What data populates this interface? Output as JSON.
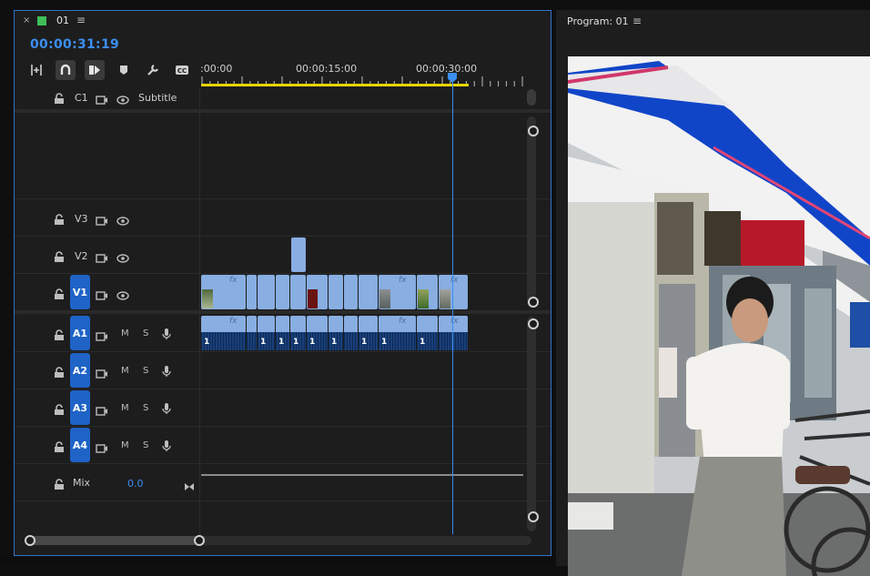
{
  "sequence_panel": {
    "close_glyph": "×",
    "tab_name": "01",
    "tab_swatch_color": "#3fbf5a",
    "menu_glyph": "≡",
    "timecode": "00:00:31:19",
    "tools": [
      "ripple-insert-icon",
      "snap-magnet-icon",
      "linked-selection-icon",
      "add-marker-icon",
      "wrench-icon",
      "captions-icon"
    ],
    "ruler_labels": [
      ":00:00",
      "00:00:15:00",
      "00:00:30:00"
    ],
    "playhead_timecode_fraction": 0.887
  },
  "tracks": {
    "caption": {
      "name": "C1",
      "label": "Subtitle"
    },
    "video": [
      {
        "name": "V3"
      },
      {
        "name": "V2"
      },
      {
        "name": "V1",
        "target": true
      }
    ],
    "audio": [
      {
        "name": "A1",
        "m": "M",
        "s": "S"
      },
      {
        "name": "A2",
        "m": "M",
        "s": "S"
      },
      {
        "name": "A3",
        "m": "M",
        "s": "S"
      },
      {
        "name": "A4",
        "m": "M",
        "s": "S"
      }
    ],
    "mix": {
      "label": "Mix",
      "value": "0.0"
    }
  },
  "clips": {
    "fx_label": "fx",
    "audio_channel_label": "1"
  },
  "program_panel": {
    "title": "Program: 01",
    "menu_glyph": "≡"
  },
  "colors": {
    "accent": "#3c8ef2",
    "clip": "#88aee2",
    "track_button": "#1f63c6",
    "playhead_bar": "#e6d400"
  }
}
